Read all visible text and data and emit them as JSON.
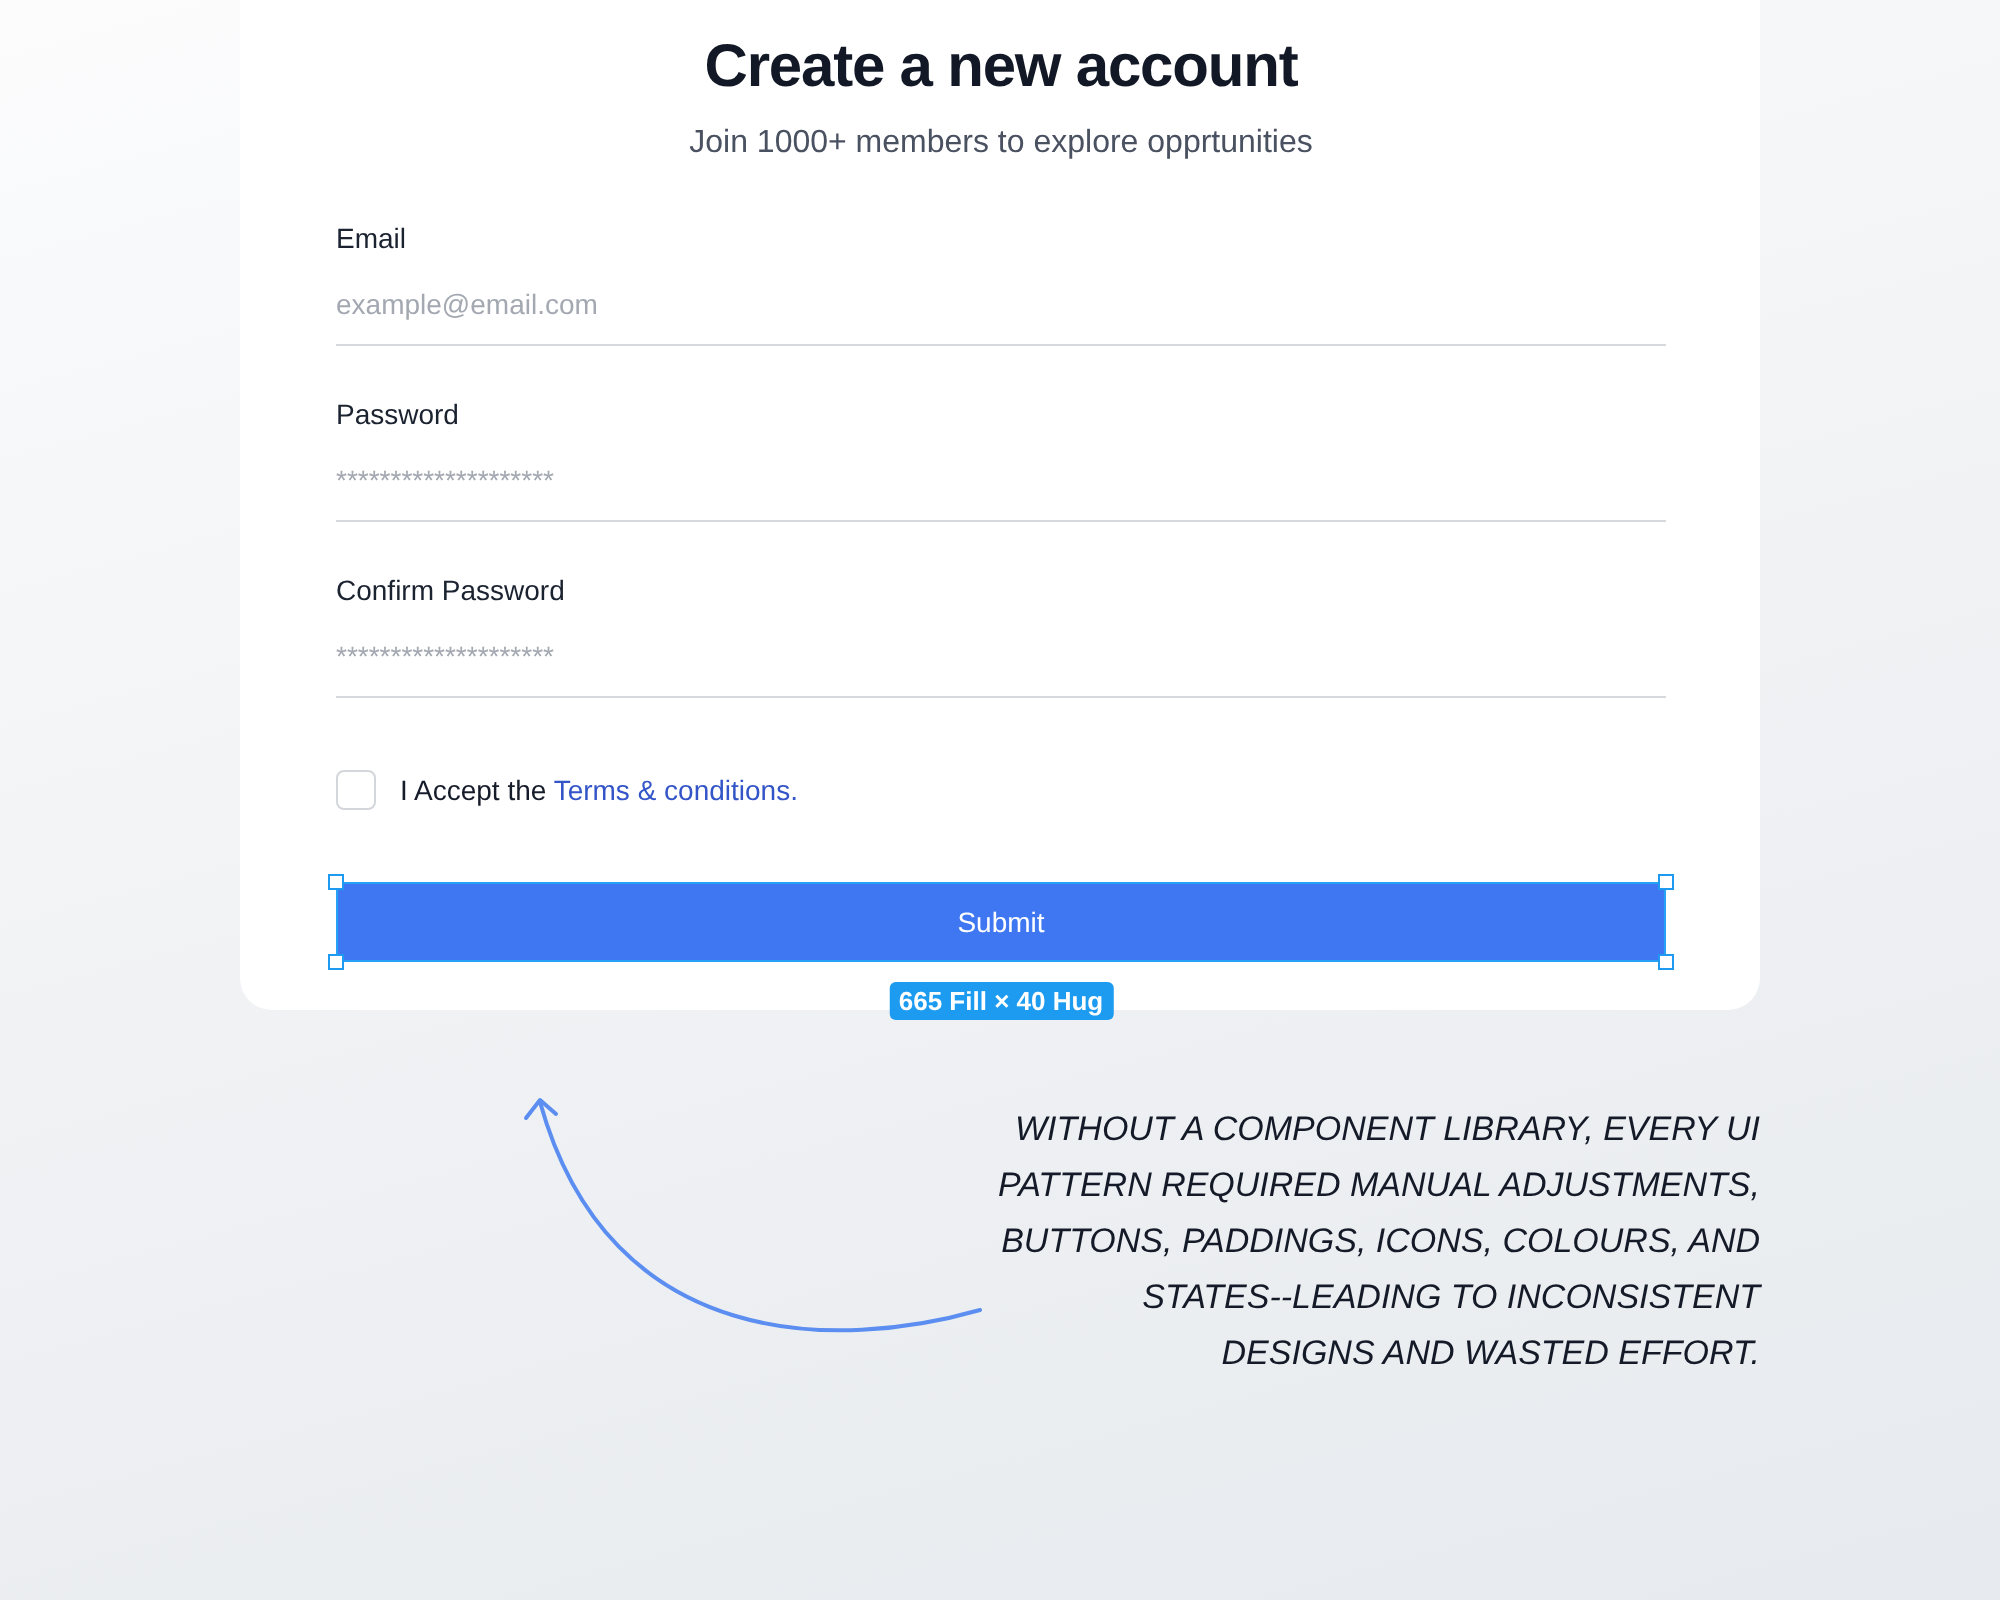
{
  "form": {
    "title": "Create a new account",
    "subtitle": "Join 1000+ members to explore opprtunities",
    "fields": [
      {
        "label": "Email",
        "placeholder": "example@email.com"
      },
      {
        "label": "Password",
        "placeholder": "********************"
      },
      {
        "label": "Confirm Password",
        "placeholder": "********************"
      }
    ],
    "terms": {
      "checked": false,
      "text": "I Accept the",
      "link": "Terms & conditions."
    },
    "submit": {
      "label": "Submit",
      "selection": {
        "label": "665 Fill × 40 Hug"
      }
    }
  },
  "annotation": {
    "text": "WITHOUT A COMPONENT LIBRARY, EVERY UI\nPATTERN REQUIRED MANUAL ADJUSTMENTS,\nBUTTONS, PADDINGS, ICONS, COLOURS, AND\nSTATES--LEADING TO INCONSISTENT\nDESIGNS AND WASTED EFFORT."
  }
}
